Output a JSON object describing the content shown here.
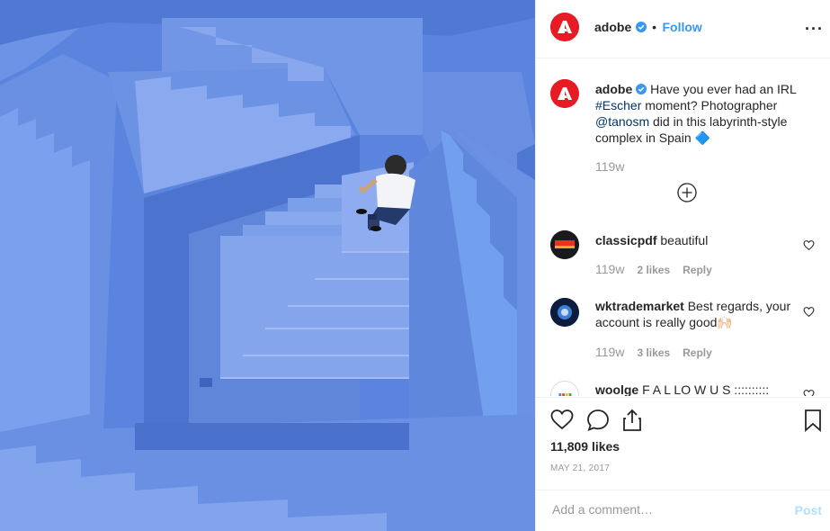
{
  "post": {
    "author": "adobe",
    "follow_separator": "•",
    "follow_label": "Follow",
    "more_label": "···"
  },
  "caption": {
    "author": "adobe",
    "text_1": " Have you ever had an IRL ",
    "hashtag": "#Escher",
    "text_2": " moment? Photographer ",
    "mention": "@tanosm",
    "text_3": " did in this labyrinth-style complex in Spain ",
    "emoji": "🔷",
    "time": "119w"
  },
  "comments": [
    {
      "author": "classicpdf",
      "text": " beautiful",
      "time": "119w",
      "likes": "2 likes",
      "reply": "Reply"
    },
    {
      "author": "wktrademarket",
      "text": " Best regards, your account is really good🙌🏻",
      "time": "119w",
      "likes": "3 likes",
      "reply": "Reply"
    },
    {
      "author": "woolge",
      "text": " F A L LO W U S ::::::::::"
    }
  ],
  "stats": {
    "likes": "11,809 likes",
    "date": "MAY 21, 2017"
  },
  "composer": {
    "placeholder": "Add a comment…",
    "post_label": "Post"
  },
  "icons": [
    "adobe-logo-icon",
    "verified-icon",
    "load-more-icon",
    "heart-icon",
    "comment-icon",
    "share-icon",
    "bookmark-icon"
  ],
  "colors": {
    "accent": "#3897f0",
    "adobe_red": "#e61b23",
    "photo_blue": "#5b86e0"
  }
}
